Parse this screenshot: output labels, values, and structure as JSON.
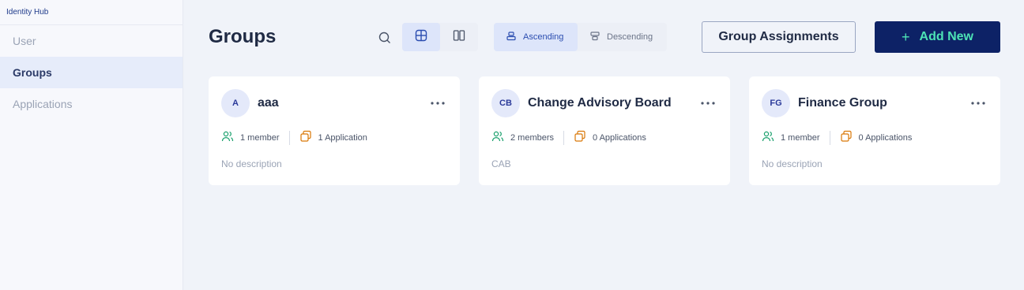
{
  "app": {
    "title": "Identity Hub"
  },
  "sidebar": {
    "items": [
      {
        "label": "User",
        "active": false
      },
      {
        "label": "Groups",
        "active": true
      },
      {
        "label": "Applications",
        "active": false
      }
    ]
  },
  "header": {
    "title": "Groups",
    "sort": {
      "ascending": "Ascending",
      "descending": "Descending",
      "selected": "ascending"
    },
    "view": {
      "selected": "grid"
    },
    "group_assignments_label": "Group Assignments",
    "add_new_label": "Add New"
  },
  "colors": {
    "accent": "#0d2266",
    "accent_text": "#4de3b5",
    "member_icon": "#1aa06d",
    "application_icon": "#d97706"
  },
  "icons": {
    "search": "search-icon",
    "grid_view": "grid-view-icon",
    "column_view": "column-view-icon",
    "sort_ascending": "sort-ascending-icon",
    "sort_descending": "sort-descending-icon",
    "add": "plus-icon",
    "more": "more-horizontal-icon",
    "members": "users-icon",
    "applications": "applications-icon"
  },
  "groups": [
    {
      "initials": "A",
      "name": "aaa",
      "members": "1 member",
      "applications": "1 Application",
      "description": "No description"
    },
    {
      "initials": "CB",
      "name": "Change Advisory Board",
      "members": "2 members",
      "applications": "0 Applications",
      "description": "CAB"
    },
    {
      "initials": "FG",
      "name": "Finance Group",
      "members": "1 member",
      "applications": "0 Applications",
      "description": "No description"
    }
  ]
}
